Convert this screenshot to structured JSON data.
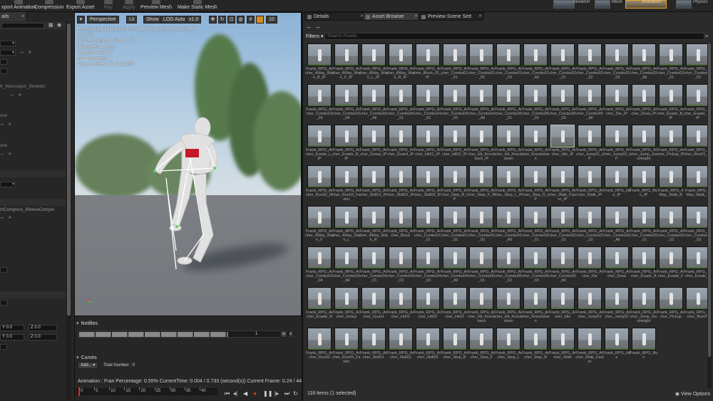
{
  "toolbar": {
    "buttons": [
      "xport Animation",
      "Compression",
      "Export Asset",
      "Key",
      "Apply",
      "Preview Mesh",
      "Make Static Mesh"
    ],
    "mode_labels": [
      "Skeleton",
      "Mesh",
      "Animation",
      "Physics"
    ]
  },
  "left_panel": {
    "tab_label": "ails",
    "skeleton_text": "K_Mannequin_Skeleton",
    "group_one": "one",
    "group_two": "one",
    "compression_text": "mCompress_BitwiseCompre",
    "vec_a": [
      "Y",
      "0.0",
      "Z",
      "0.0"
    ],
    "vec_b": [
      "Y",
      "0.0",
      "Z",
      "0.0"
    ]
  },
  "viewport": {
    "buttons": {
      "perspective": "Perspective",
      "lit": "Lit",
      "show": "Show",
      "lod": "LOD Auto",
      "speed": "x1.0",
      "snap": "10"
    },
    "preview_title": "Previewing Animation Frank_RPG_Archer_Run02_IP",
    "stats": [
      "LOD: 0",
      "Current Screen Size: 1.37",
      "Triangles: 41062",
      "Vertices: 23215",
      "UV Channels: 1",
      "Approx Size: 27x112x293"
    ]
  },
  "notifies": {
    "header": "Notifies",
    "track_number": "1"
  },
  "curves": {
    "header": "Curves",
    "add_label": "Add...",
    "total_label": "Total Number : 0"
  },
  "timeline": {
    "info": "Animation :  Fran Percentage:  0.55% CurrentTime:  0.004 / 0.733 (second(s)) Current Frame:  0.24 / 44 Frame",
    "ticks": [
      "0",
      "5",
      "10",
      "15",
      "20",
      "25",
      "30",
      "35",
      "40"
    ],
    "playback_icons": [
      "skip-start",
      "step-back",
      "play-reverse",
      "record",
      "pause",
      "step-forward",
      "skip-end",
      "loop"
    ]
  },
  "right_panel": {
    "tabs": [
      "Details",
      "Asset Browser",
      "Preview Scene Sett"
    ],
    "filters_label": "Filters",
    "search_placeholder": "Search Assets",
    "status": "118 items (1 selected)",
    "view_options": "View Options",
    "selected_index": 39,
    "assets": [
      "Frank_RPG_Archer_4Way_Walk_B_IP",
      "Frank_RPG_Archer_4Way_Walk_F_IP",
      "Frank_RPG_Archer_4Way_Walk_L_IP",
      "Frank_RPG_Archer_4Way_Walk_R_IP",
      "Frank_RPG_Archer_Block_01_IP",
      "Frank_RPG_Archer_Combo01_01",
      "Frank_RPG_Archer_Combo01_02",
      "Frank_RPG_Archer_Combo01_03",
      "Frank_RPG_Archer_Combo01_All",
      "Frank_RPG_Archer_Combo02_01",
      "Frank_RPG_Archer_Combo02_02",
      "Frank_RPG_Archer_Combo02_03",
      "Frank_RPG_Archer_Combo02_All",
      "Frank_RPG_Archer_Combo03_01",
      "Frank_RPG_Archer_Combo03_02",
      "Frank_RPG_Archer_Combo03_03",
      "Frank_RPG_Archer_Combo03_04",
      "Frank_RPG_Archer_Combo03_All",
      "Frank_RPG_Archer_Combo04_01",
      "Frank_RPG_Archer_Combo04_02",
      "Frank_RPG_Archer_Combo04_03",
      "Frank_RPG_Archer_Combo04_All",
      "Frank_RPG_Archer_Combo05_01",
      "Frank_RPG_Archer_Combo05_02",
      "Frank_RPG_Archer_Combo05_03",
      "Frank_RPG_Archer_Combo05_All",
      "Frank_RPG_Archer_Die_IP",
      "Frank_RPG_Archer_Draw_IP",
      "Frank_RPG_Archer_Evade_B_IP",
      "Frank_RPG_Archer_Evade_F_IP",
      "Frank_RPG_Archer_Evade_L_IP",
      "Frank_RPG_Archer_Evade_R_IP",
      "Frank_RPG_Archer_Getup_IP",
      "Frank_RPG_Archer_Guard_IP",
      "Frank_RPG_Archer_Hit01_IP",
      "Frank_RPG_Archer_Hit02_IP",
      "Frank_RPG_Archer_Hit_Knockback_IP",
      "Frank_RPG_Archer_Hit_Knockdown",
      "Frank_RPG_Archer_Knockdown",
      "Frank_RPG_Archer_Idle_IP",
      "Frank_RPG_Archer_Jump01_IP",
      "Frank_RPG_Archer_Jump02_IP",
      "Frank_RPG_Archer_Jump_ZeroHeight",
      "Frank_RPG_Archer_Pickup_IP",
      "Frank_RPG_Archer_Run01_IP",
      "Frank_RPG_Archer_Run02_IP",
      "Frank_RPG_Archer_Run03_Faster",
      "Frank_RPG_Archer_Skill01_IP",
      "Frank_RPG_Archer_Skill02_IP",
      "Frank_RPG_Archer_Skill03_IP",
      "Frank_RPG_Archer_Step_B_IP",
      "Frank_RPG_Archer_Step_F_IP",
      "Frank_RPG_Archer_Step_L_IP",
      "Frank_RPG_Archer_Step_R_IP",
      "Frank_RPG_Archer_Walk_Faster_IP",
      "Frank_RPG_Archer_Walk_IP",
      "Frank_RPG_Idle_IP",
      "Frank_RPG_Run_IP",
      "Frank_RPG_4Way_Walk_B",
      "Frank_RPG_4Way_Walk_F",
      "Frank_RPG_Archer_4Way_Walk_F",
      "Frank_RPG_Archer_4Way_Walk_L",
      "Frank_RPG_Archer_4Way_Walk_R",
      "Frank_RPG_Archer_Block",
      "Frank_RPG_Archer_Combo01_01",
      "Frank_RPG_Archer_Combo01_02",
      "Frank_RPG_Archer_Combo01_03",
      "Frank_RPG_Archer_Combo01_All",
      "Frank_RPG_Archer_Combo02_01",
      "Frank_RPG_Archer_Combo02_02",
      "Frank_RPG_Archer_Combo02_03",
      "Frank_RPG_Archer_Combo02_All",
      "Frank_RPG_Archer_Combo03_01",
      "Frank_RPG_Archer_Combo03_02",
      "Frank_RPG_Archer_Combo03_03",
      "Frank_RPG_Archer_Combo03_04",
      "Frank_RPG_Archer_Combo03_All",
      "Frank_RPG_Archer_Combo04_01",
      "Frank_RPG_Archer_Combo04_02",
      "Frank_RPG_Archer_Combo04_03",
      "Frank_RPG_Archer_Combo04_All",
      "Frank_RPG_Archer_Combo05_01",
      "Frank_RPG_Archer_Combo05_02",
      "Frank_RPG_Archer_Combo05_03",
      "Frank_RPG_Archer_Combo05_All",
      "Frank_RPG_Archer_Die",
      "Frank_RPG_Archer_Draw",
      "Frank_RPG_Archer_Evade_B",
      "Frank_RPG_Archer_Evade_F",
      "Frank_RPG_Archer_Evade_L",
      "Frank_RPG_Archer_Evade_R",
      "Frank_RPG_Archer_Getup",
      "Frank_RPG_Archer_Guard",
      "Frank_RPG_Archer_Hit01",
      "Frank_RPG_Archer_Hit02",
      "Frank_RPG_Archer_Hit03",
      "Frank_RPG_Archer_Hit_Knockback",
      "Frank_RPG_Archer_Hit_Knockdown",
      "Frank_RPG_Archer_Knockdown",
      "Frank_RPG_Archer_Idle",
      "Frank_RPG_Archer_Jump01",
      "Frank_RPG_Archer_Jump02",
      "Frank_RPG_Archer_Jump_ZeroHeight",
      "Frank_RPG_Archer_Pickup",
      "Frank_RPG_Archer_Run01",
      "Frank_RPG_Archer_Run02",
      "Frank_RPG_Archer_Run03_Faster",
      "Frank_RPG_Archer_Skill01",
      "Frank_RPG_Archer_Skill02",
      "Frank_RPG_Archer_Skill03",
      "Frank_RPG_Archer_Step_B",
      "Frank_RPG_Archer_Step_F",
      "Frank_RPG_Archer_Step_L",
      "Frank_RPG_Archer_Step_R",
      "Frank_RPG_Archer_Walk",
      "Frank_RPG_Archer_Walk_Faster",
      "Frank_RPG_Idle",
      "Frank_RPG_Run"
    ]
  }
}
